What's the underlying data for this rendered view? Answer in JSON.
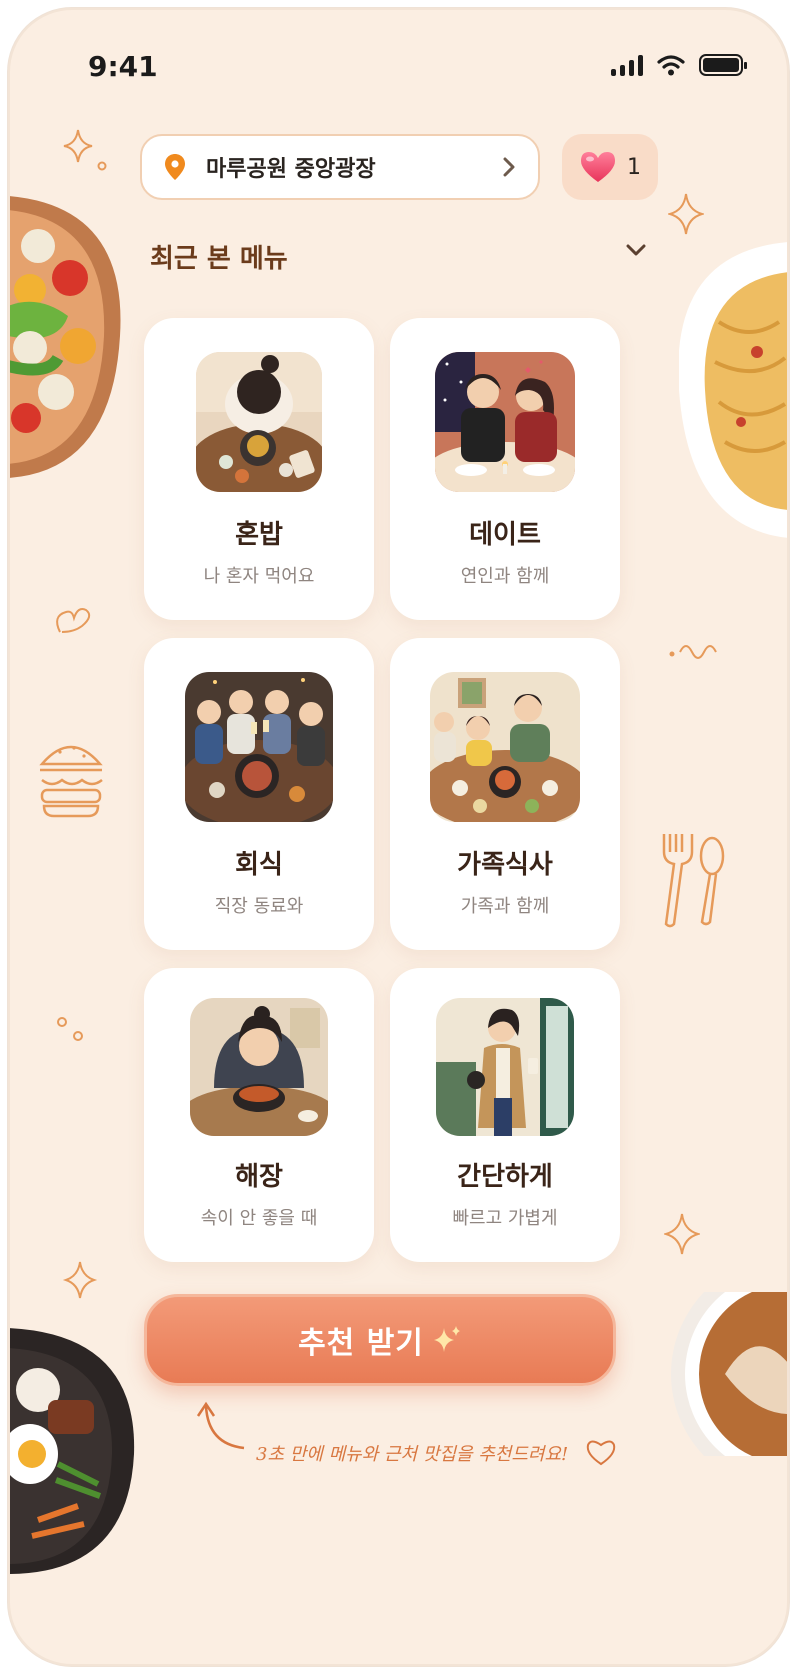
{
  "status_bar": {
    "time": "9:41"
  },
  "location": {
    "name": "마루공원 중앙광장"
  },
  "favorites": {
    "count": "1"
  },
  "section": {
    "title": "최근 본 메뉴"
  },
  "cards": [
    {
      "title": "혼밥",
      "subtitle": "나 혼자 먹어요"
    },
    {
      "title": "데이트",
      "subtitle": "연인과 함께"
    },
    {
      "title": "회식",
      "subtitle": "직장 동료와"
    },
    {
      "title": "가족식사",
      "subtitle": "가족과 함께"
    },
    {
      "title": "해장",
      "subtitle": "속이 안 좋을 때"
    },
    {
      "title": "간단하게",
      "subtitle": "빠르고 가볍게"
    }
  ],
  "cta": {
    "label": "추천 받기"
  },
  "hint": {
    "text": "3초 만에 메뉴와 근처 맛집을 추천드려요!"
  },
  "colors": {
    "background": "#fbeee2",
    "accent": "#e87b55",
    "text_brown": "#6b3b1b",
    "pin": "#f08a1e"
  }
}
